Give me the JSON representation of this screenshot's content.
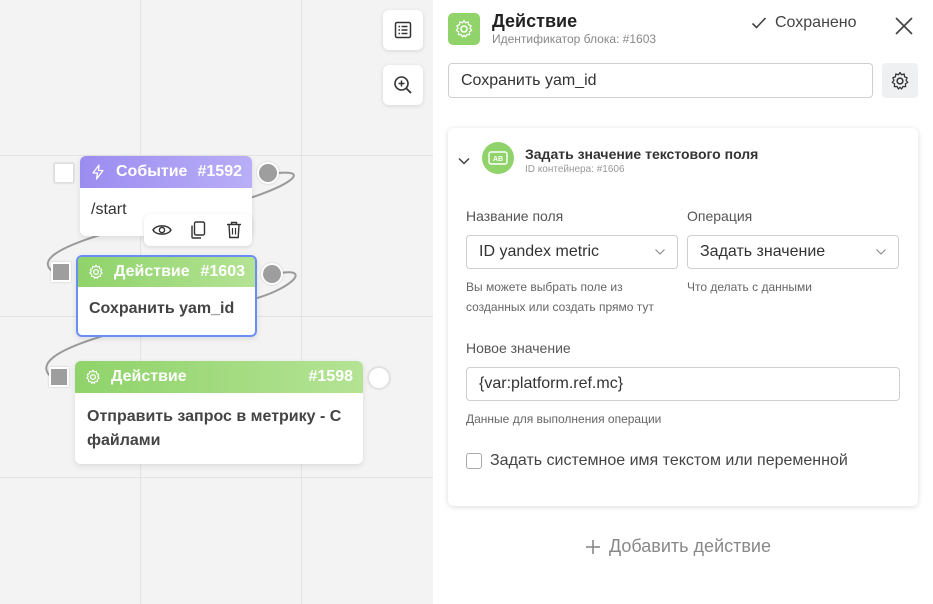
{
  "canvas": {
    "nodes": [
      {
        "type": "Событие",
        "id": "#1592",
        "text": "/start",
        "icon": "lightning-icon"
      },
      {
        "type": "Действие",
        "id": "#1603",
        "text": "Сохранить yam_id",
        "icon": "gear-icon",
        "selected": true
      },
      {
        "type": "Действие",
        "id": "#1598",
        "text": "Отправить запрос в метрику - С файлами",
        "icon": "gear-icon"
      }
    ],
    "tools": [
      "list-icon",
      "zoom-in-icon"
    ],
    "node_toolbar": [
      "eye-icon",
      "copy-icon",
      "trash-icon"
    ]
  },
  "panel": {
    "title": "Действие",
    "subtitle": "Идентификатор блока: #1603",
    "saved_label": "Сохранено",
    "block_name": "Сохранить yam_id",
    "card": {
      "title": "Задать значение текстового поля",
      "subtitle": "ID контейнера: #1606",
      "field_label": "Название поля",
      "field_value": "ID yandex metric",
      "field_hint_1": "Вы можете выбрать поле из",
      "field_hint_2": "созданных или создать прямо тут",
      "operation_label": "Операция",
      "operation_value": "Задать значение",
      "operation_hint": "Что делать с данными",
      "new_value_label": "Новое значение",
      "new_value": "{var:platform.ref.mc}",
      "new_value_hint": "Данные для выполнения операции",
      "system_name_label": "Задать системное имя текстом или переменной"
    },
    "add_action_label": "Добавить действие"
  },
  "colors": {
    "event_header": "#9b8cf0",
    "action_header": "#8fd36a",
    "selected_border": "#6b8ef5"
  }
}
